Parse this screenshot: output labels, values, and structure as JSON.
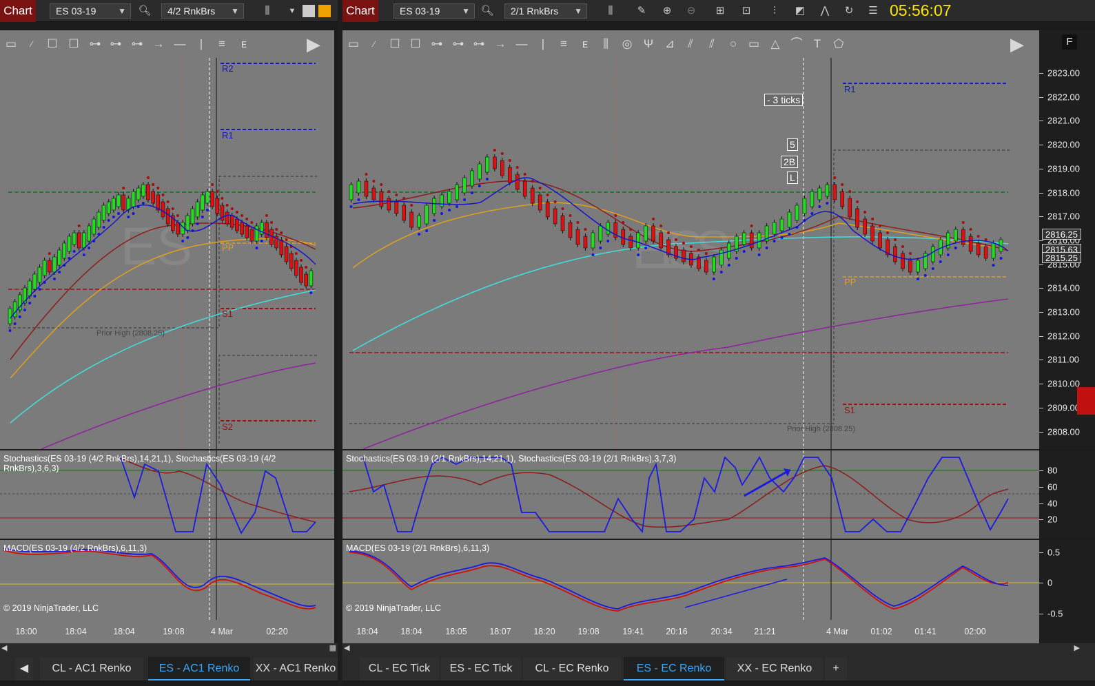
{
  "clock": "05:56:07",
  "left": {
    "chart_button": "Chart",
    "instrument": "ES 03-19",
    "bars": "4/2 RnkBrs",
    "watermark": "ES",
    "levels": {
      "r2": "R2",
      "r1": "R1",
      "pp": "PP",
      "s1": "S1",
      "s2": "S2",
      "prior_high": "Prior High (2808.25)"
    },
    "stoch_label": "Stochastics(ES 03-19 (4/2 RnkBrs),14,21,1), Stochastics(ES 03-19 (4/2 RnkBrs),3,6,3)",
    "macd_label": "MACD(ES 03-19 (4/2 RnkBrs),6,11,3)",
    "copyright": "© 2019 NinjaTrader, LLC",
    "time_labels": [
      "18:00",
      "18:04",
      "18:04",
      "19:08",
      "4 Mar",
      "02:20"
    ],
    "tabs": [
      "CL - AC1 Renko",
      "ES - AC1 Renko",
      "XX - AC1 Renko"
    ],
    "active_tab": 1
  },
  "right": {
    "chart_button": "Chart",
    "instrument": "ES 03-19",
    "bars": "2/1 RnkBrs",
    "watermark": "ES",
    "levels": {
      "r1": "R1",
      "pp": "PP",
      "s1": "S1",
      "prior_high": "Prior High (2808.25)"
    },
    "annotations": {
      "ticks": "- 3 ticks",
      "a": "5",
      "b": "2B",
      "c": "L"
    },
    "stoch_label": "Stochastics(ES 03-19 (2/1 RnkBrs),14,21,1), Stochastics(ES 03-19 (2/1 RnkBrs),3,7,3)",
    "macd_label": "MACD(ES 03-19 (2/1 RnkBrs),6,11,3)",
    "copyright": "© 2019 NinjaTrader, LLC",
    "time_labels": [
      "18:04",
      "18:04",
      "18:05",
      "18:07",
      "18:20",
      "19:08",
      "19:41",
      "20:16",
      "20:34",
      "21:21",
      "4 Mar",
      "01:02",
      "01:41",
      "02:00"
    ],
    "price_axis": [
      "2823.00",
      "2822.00",
      "2821.00",
      "2820.00",
      "2819.00",
      "2818.00",
      "2817.00",
      "2816.00",
      "2815.00",
      "2814.00",
      "2813.00",
      "2812.00",
      "2811.00",
      "2810.00",
      "2809.00",
      "2808.00"
    ],
    "price_boxes": [
      "2816.25",
      "2815.63",
      "2815.25"
    ],
    "stoch_axis": [
      "80",
      "60",
      "40",
      "20"
    ],
    "macd_axis": [
      "0.5",
      "0",
      "-0.5"
    ],
    "corner": "F",
    "tabs": [
      "CL - EC Tick",
      "ES - EC Tick",
      "CL - EC Renko",
      "ES - EC Renko",
      "XX - EC Renko"
    ],
    "add_tab": "+",
    "active_tab": 3
  },
  "colors": {
    "chart_bg": "#7b7b7b",
    "up_bar": "#22dd22",
    "down_bar": "#dd1111",
    "pivot_blue": "#1515c8",
    "pivot_red": "#a01010",
    "pp_orange": "#e0a020",
    "cyan_ma": "#40e0e0",
    "purple_ma": "#9020a0",
    "stoch_blue": "#1a1ae0",
    "clock_yellow": "#ffe800",
    "tab_active": "#38a8ff"
  }
}
